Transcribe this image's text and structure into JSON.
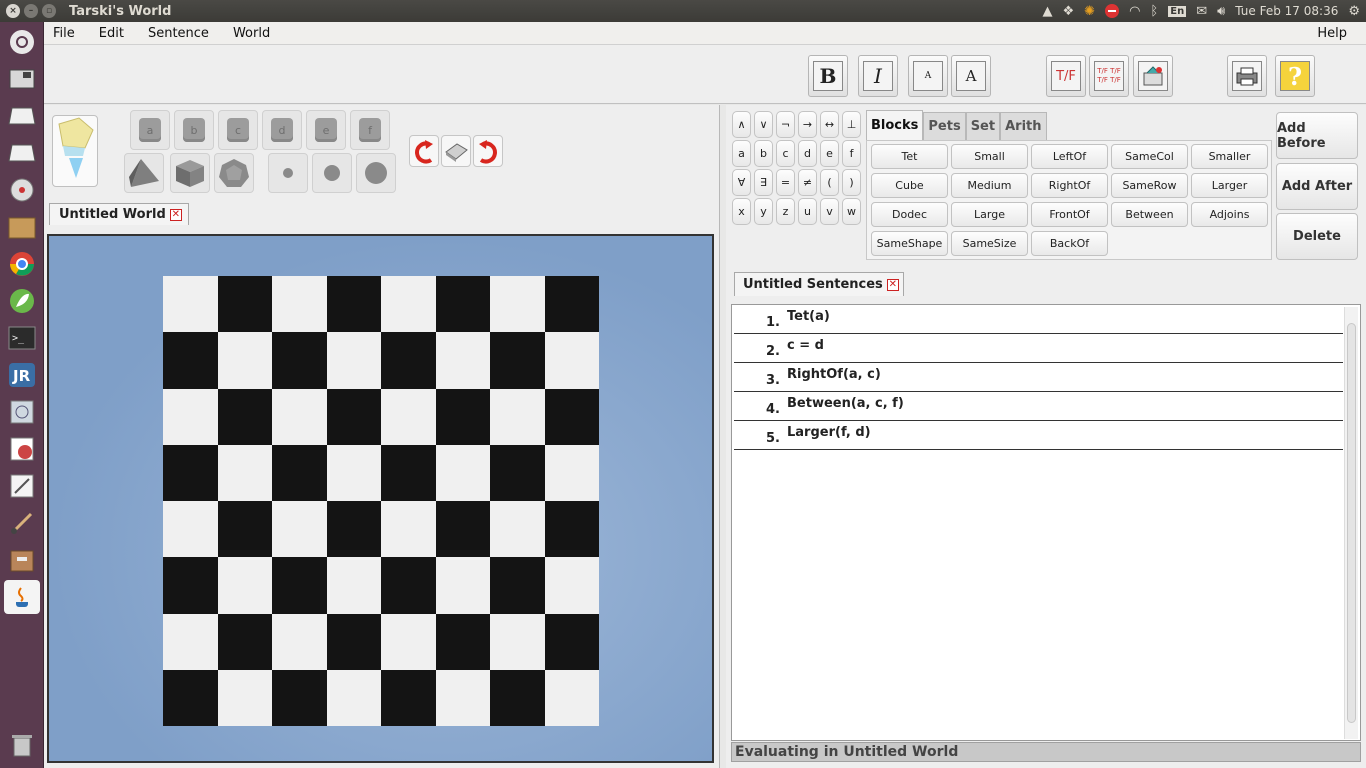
{
  "system_bar": {
    "app_title": "Tarski's World",
    "keyboard_layout": "En",
    "datetime": "Tue Feb 17 08:36"
  },
  "menu": {
    "file": "File",
    "edit": "Edit",
    "sentence": "Sentence",
    "world": "World",
    "help": "Help"
  },
  "format_toolbar": {
    "bold": "B",
    "italic": "I",
    "small_font": "A",
    "large_font": "A",
    "verify_one": "T/F",
    "verify_all_1": "T/F T/F",
    "verify_all_2": "T/F T/F"
  },
  "block_palette": {
    "names": [
      "a",
      "b",
      "c",
      "d",
      "e",
      "f"
    ]
  },
  "world": {
    "tab_label": "Untitled World",
    "board_size": 8,
    "board_colors": {
      "light": "#f0f0f0",
      "dark": "#141414"
    }
  },
  "symbols": {
    "row1": [
      "∧",
      "∨",
      "¬",
      "→",
      "↔",
      "⊥"
    ],
    "row2": [
      "a",
      "b",
      "c",
      "d",
      "e",
      "f"
    ],
    "row3": [
      "∀",
      "∃",
      "=",
      "≠",
      "(",
      ")"
    ],
    "row4": [
      "x",
      "y",
      "z",
      "u",
      "v",
      "w"
    ]
  },
  "predicate_tabs": [
    "Blocks",
    "Pets",
    "Set",
    "Arith"
  ],
  "predicates": {
    "col1": [
      "Tet",
      "Cube",
      "Dodec",
      "SameShape"
    ],
    "col2": [
      "Small",
      "Medium",
      "Large",
      "SameSize"
    ],
    "col3": [
      "LeftOf",
      "RightOf",
      "FrontOf",
      "BackOf"
    ],
    "col4": [
      "SameCol",
      "SameRow",
      "Between"
    ],
    "col5": [
      "Smaller",
      "Larger",
      "Adjoins"
    ]
  },
  "actions": {
    "add_before": "Add Before",
    "add_after": "Add After",
    "delete": "Delete"
  },
  "sentences": {
    "tab_label": "Untitled Sentences",
    "items": [
      {
        "num": "1.",
        "text": "Tet(a)"
      },
      {
        "num": "2.",
        "text": "c = d"
      },
      {
        "num": "3.",
        "text": "RightOf(a, c)"
      },
      {
        "num": "4.",
        "text": "Between(a, c, f)"
      },
      {
        "num": "5.",
        "text": "Larger(f, d)"
      }
    ]
  },
  "status": "Evaluating in Untitled World"
}
